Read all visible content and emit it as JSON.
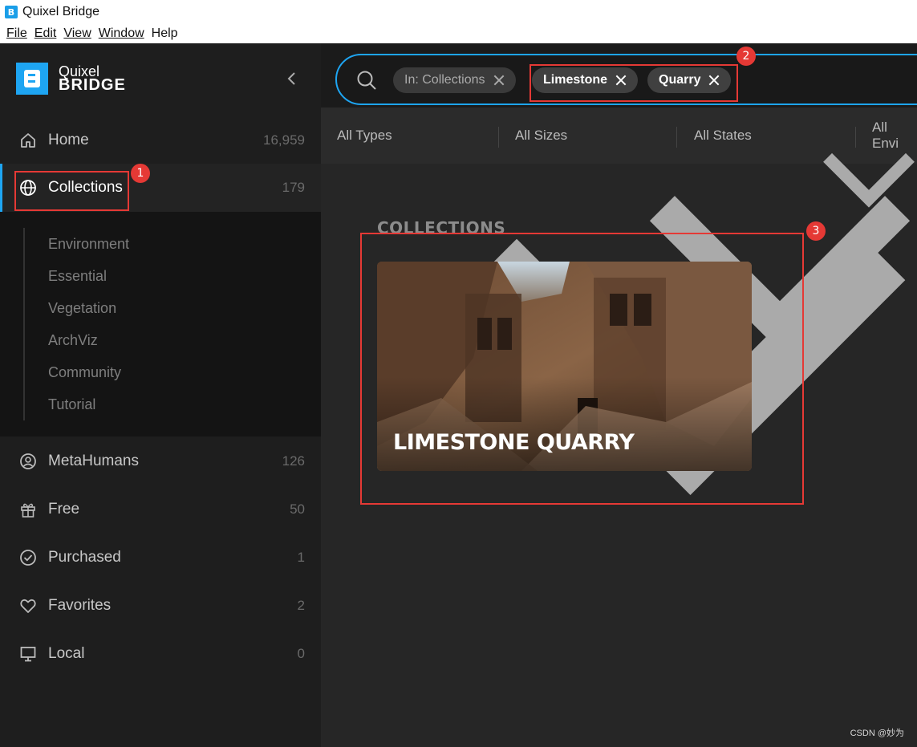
{
  "window": {
    "title": "Quixel Bridge",
    "app_icon_letter": "B"
  },
  "menu": [
    "File",
    "Edit",
    "View",
    "Window",
    "Help"
  ],
  "logo": {
    "line1": "Quixel",
    "line2": "BRIDGE"
  },
  "sidebar": {
    "items": [
      {
        "label": "Home",
        "count": "16,959",
        "icon": "home-icon"
      },
      {
        "label": "Collections",
        "count": "179",
        "icon": "globe-icon"
      },
      {
        "label": "MetaHumans",
        "count": "126",
        "icon": "user-circle-icon"
      },
      {
        "label": "Free",
        "count": "50",
        "icon": "gift-icon"
      },
      {
        "label": "Purchased",
        "count": "1",
        "icon": "check-circle-icon"
      },
      {
        "label": "Favorites",
        "count": "2",
        "icon": "heart-icon"
      },
      {
        "label": "Local",
        "count": "0",
        "icon": "monitor-icon"
      }
    ],
    "sub_items": [
      "Environment",
      "Essential",
      "Vegetation",
      "ArchViz",
      "Community",
      "Tutorial"
    ]
  },
  "search": {
    "chips": [
      {
        "label": "In: Collections"
      },
      {
        "label": "Limestone"
      },
      {
        "label": "Quarry"
      }
    ]
  },
  "filters": [
    "All Types",
    "All Sizes",
    "All States",
    "All Envi"
  ],
  "content": {
    "section_title": "COLLECTIONS",
    "card_title": "LIMESTONE QUARRY"
  },
  "annotations": [
    "1",
    "2",
    "3"
  ],
  "watermark": "CSDN @妙为",
  "colors": {
    "accent": "#1ea5f2",
    "annotation": "#e53935"
  }
}
